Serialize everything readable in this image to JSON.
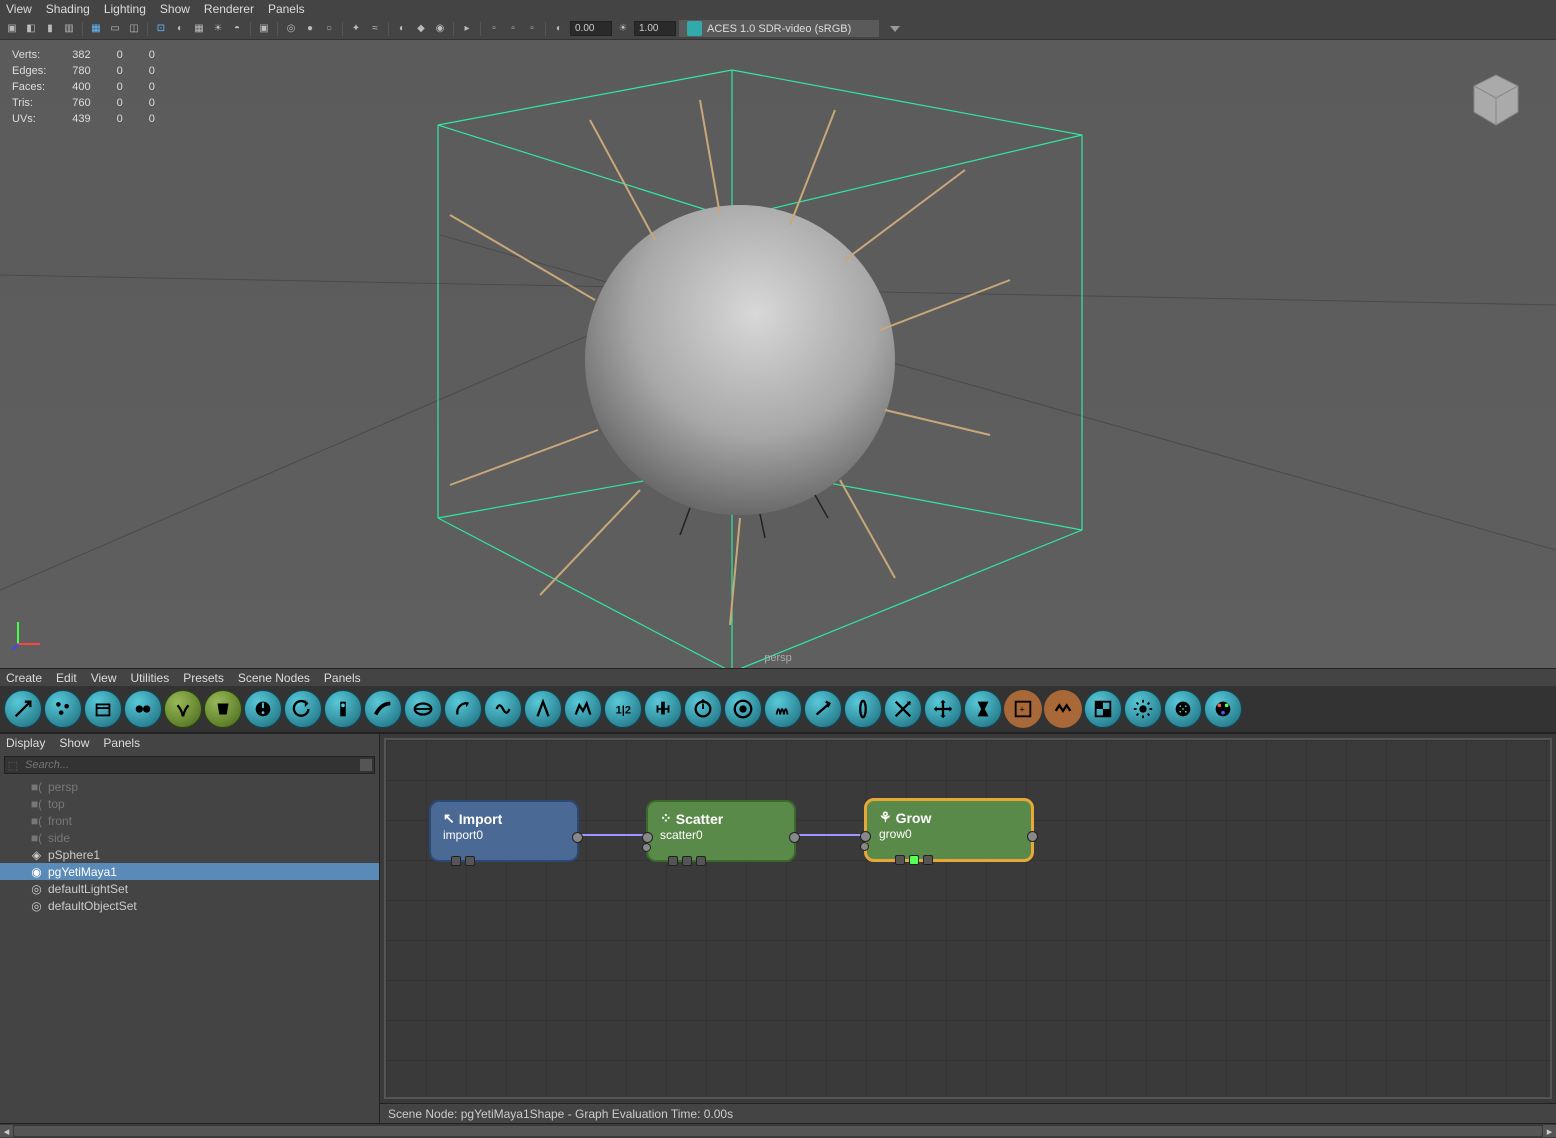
{
  "viewport_menu": [
    "View",
    "Shading",
    "Lighting",
    "Show",
    "Renderer",
    "Panels"
  ],
  "toolbar": {
    "gamma": "0.00",
    "exposure": "1.00",
    "colorspace": "ACES 1.0 SDR-video (sRGB)"
  },
  "hud": {
    "rows": [
      {
        "label": "Verts:",
        "v1": "382",
        "v2": "0",
        "v3": "0"
      },
      {
        "label": "Edges:",
        "v1": "780",
        "v2": "0",
        "v3": "0"
      },
      {
        "label": "Faces:",
        "v1": "400",
        "v2": "0",
        "v3": "0"
      },
      {
        "label": "Tris:",
        "v1": "760",
        "v2": "0",
        "v3": "0"
      },
      {
        "label": "UVs:",
        "v1": "439",
        "v2": "0",
        "v3": "0"
      }
    ],
    "camera": "persp"
  },
  "graph_menu": [
    "Create",
    "Edit",
    "View",
    "Utilities",
    "Presets",
    "Scene Nodes",
    "Panels"
  ],
  "outliner_menu": [
    "Display",
    "Show",
    "Panels"
  ],
  "outliner": {
    "search_placeholder": "Search...",
    "items": [
      {
        "label": "persp",
        "dim": true,
        "icon": "cam"
      },
      {
        "label": "top",
        "dim": true,
        "icon": "cam"
      },
      {
        "label": "front",
        "dim": true,
        "icon": "cam"
      },
      {
        "label": "side",
        "dim": true,
        "icon": "cam"
      },
      {
        "label": "pSphere1",
        "dim": false,
        "icon": "mesh"
      },
      {
        "label": "pgYetiMaya1",
        "dim": false,
        "icon": "yeti",
        "sel": true
      },
      {
        "label": "defaultLightSet",
        "dim": false,
        "icon": "set"
      },
      {
        "label": "defaultObjectSet",
        "dim": false,
        "icon": "set"
      }
    ]
  },
  "nodes": {
    "import": {
      "title": "Import",
      "sub": "import0"
    },
    "scatter": {
      "title": "Scatter",
      "sub": "scatter0"
    },
    "grow": {
      "title": "Grow",
      "sub": "grow0"
    }
  },
  "status": "Scene Node: pgYetiMaya1Shape - Graph Evaluation Time: 0.00s"
}
